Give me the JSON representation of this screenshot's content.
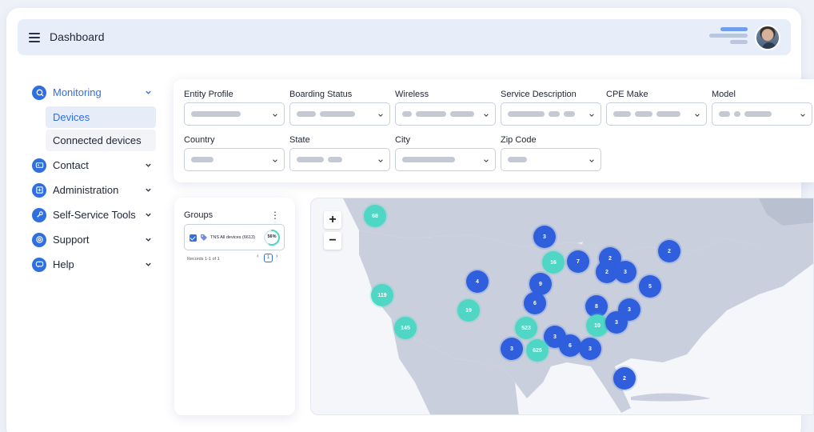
{
  "header": {
    "title": "Dashboard"
  },
  "colors": {
    "accent": "#2f6fe0",
    "cluster_blue": "#2f5fdc",
    "cluster_teal": "#4fd6c4",
    "land": "#c9cfdd",
    "sea": "#f4f6fa"
  },
  "sidebar": {
    "items": [
      {
        "label": "Monitoring",
        "icon": "monitoring-icon",
        "expanded": true,
        "subitems": [
          {
            "label": "Devices",
            "selected": true
          },
          {
            "label": "Connected devices",
            "selected": false
          }
        ]
      },
      {
        "label": "Contact",
        "icon": "contact-icon"
      },
      {
        "label": "Administration",
        "icon": "administration-icon"
      },
      {
        "label": "Self-Service Tools",
        "icon": "tools-icon"
      },
      {
        "label": "Support",
        "icon": "support-icon"
      },
      {
        "label": "Help",
        "icon": "help-icon"
      }
    ]
  },
  "filters": [
    {
      "label": "Entity Profile"
    },
    {
      "label": "Boarding Status"
    },
    {
      "label": "Wireless"
    },
    {
      "label": "Service Description"
    },
    {
      "label": "CPE Make"
    },
    {
      "label": "Model"
    },
    {
      "label": "Country"
    },
    {
      "label": "State"
    },
    {
      "label": "City"
    },
    {
      "label": "Zip Code"
    }
  ],
  "groups": {
    "title": "Groups",
    "items": [
      {
        "name": "TNS All devices (6613)",
        "percent": "56%",
        "percent_value": 0.56,
        "checked": true
      }
    ],
    "records": "Records 1-1 of 1",
    "page": "1",
    "prev": "‹",
    "next": "›"
  },
  "map": {
    "zoom_in": "+",
    "zoom_out": "−",
    "clusters": [
      {
        "count": "68",
        "color": "teal"
      },
      {
        "count": "3",
        "color": "blue"
      },
      {
        "count": "16",
        "color": "teal"
      },
      {
        "count": "7",
        "color": "blue"
      },
      {
        "count": "2",
        "color": "blue"
      },
      {
        "count": "2",
        "color": "blue"
      },
      {
        "count": "2",
        "color": "blue"
      },
      {
        "count": "3",
        "color": "blue"
      },
      {
        "count": "4",
        "color": "blue"
      },
      {
        "count": "9",
        "color": "blue"
      },
      {
        "count": "5",
        "color": "blue"
      },
      {
        "count": "119",
        "color": "teal"
      },
      {
        "count": "6",
        "color": "blue"
      },
      {
        "count": "19",
        "color": "teal"
      },
      {
        "count": "8",
        "color": "blue"
      },
      {
        "count": "3",
        "color": "blue"
      },
      {
        "count": "145",
        "color": "teal"
      },
      {
        "count": "523",
        "color": "teal"
      },
      {
        "count": "10",
        "color": "teal"
      },
      {
        "count": "3",
        "color": "blue"
      },
      {
        "count": "3",
        "color": "blue"
      },
      {
        "count": "3",
        "color": "blue"
      },
      {
        "count": "625",
        "color": "teal"
      },
      {
        "count": "6",
        "color": "blue"
      },
      {
        "count": "3",
        "color": "blue"
      },
      {
        "count": "2",
        "color": "blue"
      }
    ]
  }
}
